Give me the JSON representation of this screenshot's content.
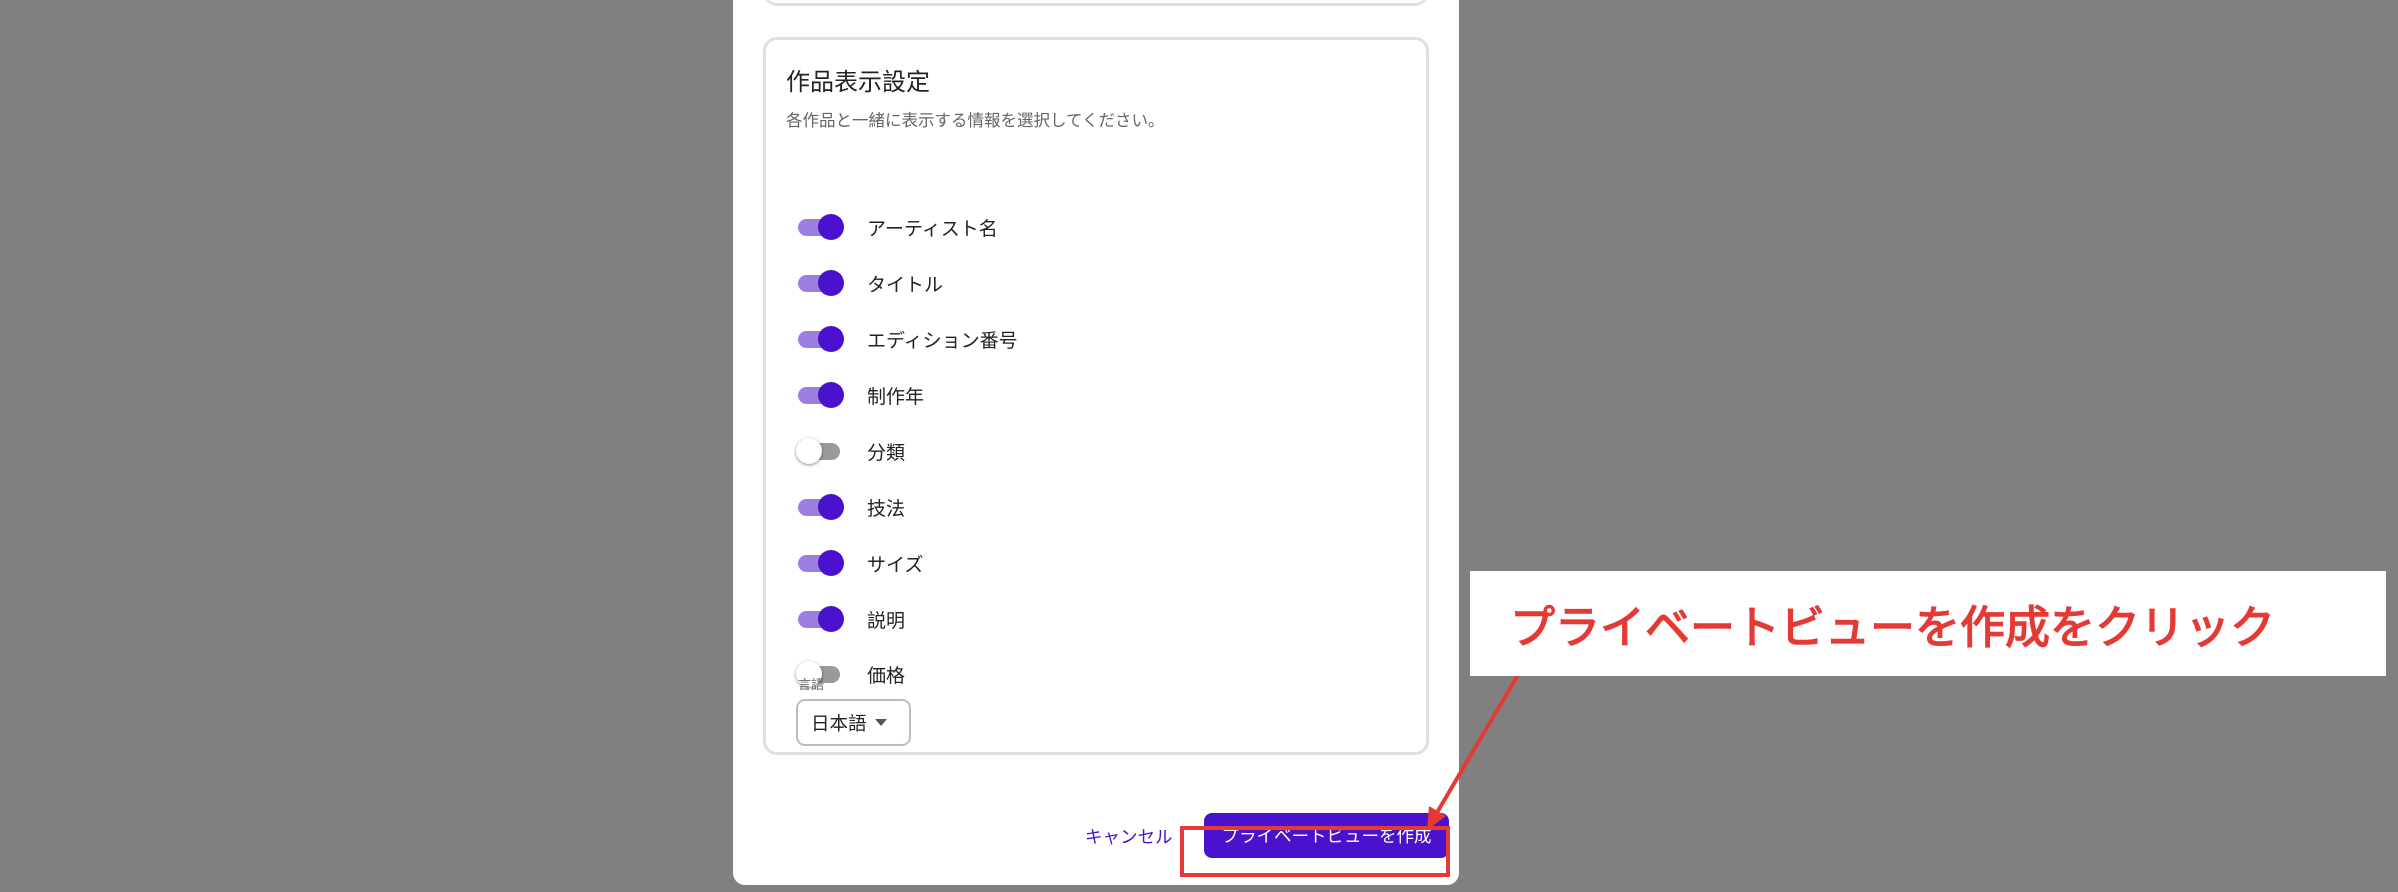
{
  "section": {
    "title": "作品表示設定",
    "description": "各作品と一緒に表示する情報を選択してください。"
  },
  "toggles": [
    {
      "label": "アーティスト名",
      "on": true
    },
    {
      "label": "タイトル",
      "on": true
    },
    {
      "label": "エディション番号",
      "on": true
    },
    {
      "label": "制作年",
      "on": true
    },
    {
      "label": "分類",
      "on": false
    },
    {
      "label": "技法",
      "on": true
    },
    {
      "label": "サイズ",
      "on": true
    },
    {
      "label": "説明",
      "on": true
    },
    {
      "label": "価格",
      "on": false
    }
  ],
  "language": {
    "caption": "言語",
    "value": "日本語"
  },
  "footer": {
    "cancel_label": "キャンセル",
    "create_label": "プライベートビューを作成"
  },
  "annotation": {
    "text": "プライベートビューを作成をクリック"
  },
  "colors": {
    "accent": "#4a12cc",
    "track_on": "#9b7fe0",
    "annotation": "#e53935",
    "overlay": "#808080"
  }
}
